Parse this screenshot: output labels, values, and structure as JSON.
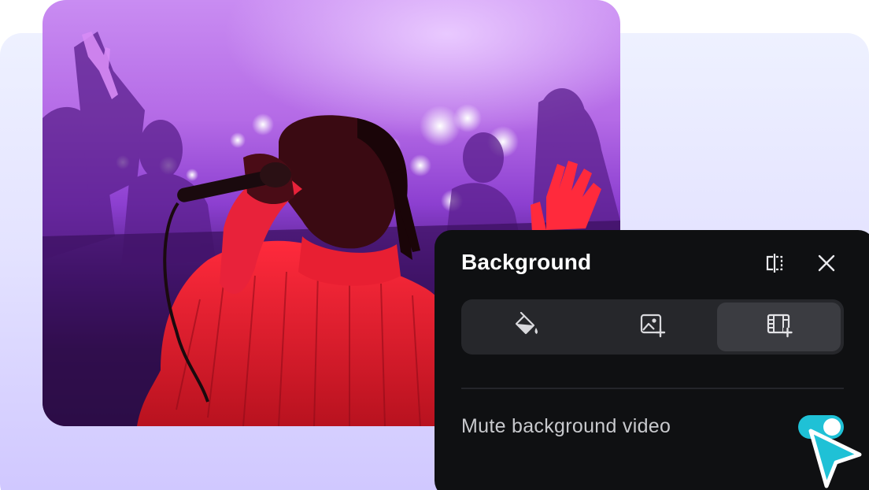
{
  "panel": {
    "title": "Background",
    "header_icons": [
      "split-view-icon",
      "close-icon"
    ],
    "tabs": [
      {
        "icon": "paint-bucket-icon",
        "active": false
      },
      {
        "icon": "add-image-icon",
        "active": false
      },
      {
        "icon": "add-video-icon",
        "active": true
      }
    ],
    "mute_label": "Mute background video",
    "mute_enabled": true
  },
  "photo": {
    "subject": "singer-with-microphone-photo"
  },
  "colors": {
    "panel_bg": "#0f1012",
    "segment_bg": "#26272b",
    "segment_active": "#3b3c41",
    "toggle_on": "#1fc1d6",
    "cursor": "#1fc1d6",
    "backdrop": "#e4e3ff"
  }
}
